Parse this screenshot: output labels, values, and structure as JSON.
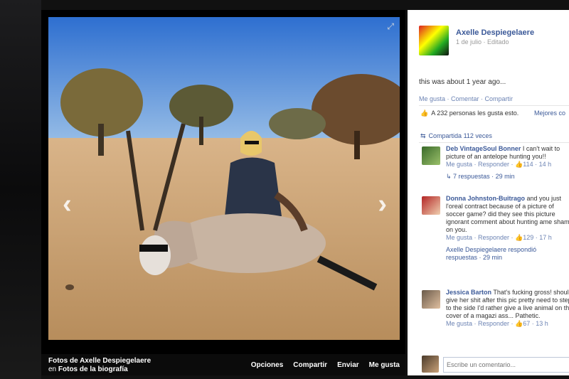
{
  "photo_viewer": {
    "prev_icon": "chevron-left-icon",
    "next_icon": "chevron-right-icon",
    "expand_icon": "expand-icon",
    "footer": {
      "album_line": "Fotos de Axelle Despiegelaere",
      "album_prefix": "en",
      "album_name": "Fotos de la biografía",
      "actions": [
        "Opciones",
        "Compartir",
        "Enviar",
        "Me gusta"
      ]
    }
  },
  "post": {
    "author": "Axelle Despiegelaere",
    "meta": "1 de julio · Editado",
    "text": "this was about 1 year ago...",
    "actions": "Me gusta · Comentar · Compartir",
    "likes_text": "A 232 personas les gusta esto.",
    "best_comments": "Mejores co",
    "shares": "Compartida 112 veces"
  },
  "comments": [
    {
      "name": "Deb VintageSoul Bonner",
      "text": "I can't wait to picture of an antelope hunting you!!",
      "meta": "Me gusta · Responder · 👍114 · 14 h",
      "replies": "7 respuestas · 29 min"
    },
    {
      "name": "Donna Johnston-Buitrago",
      "text": "and you just l'oreal contract because of a picture of soccer game? did they see this picture ignorant comment about hunting ame shame on you.",
      "meta": "Me gusta · Responder · 👍129 · 17 h",
      "reply_author": "Axelle Despiegelaere respondió",
      "replies": "respuestas · 29 min"
    },
    {
      "name": "Jessica Barton",
      "text": "That's fucking gross! should give her shit after this pic pretty need to step to the side I'd rather give a live animal on the cover of a magazi ass... Pathetic.",
      "meta": "Me gusta · Responder · 👍67 · 13 h"
    }
  ],
  "comment_box": {
    "placeholder": "Escribe un comentario..."
  }
}
